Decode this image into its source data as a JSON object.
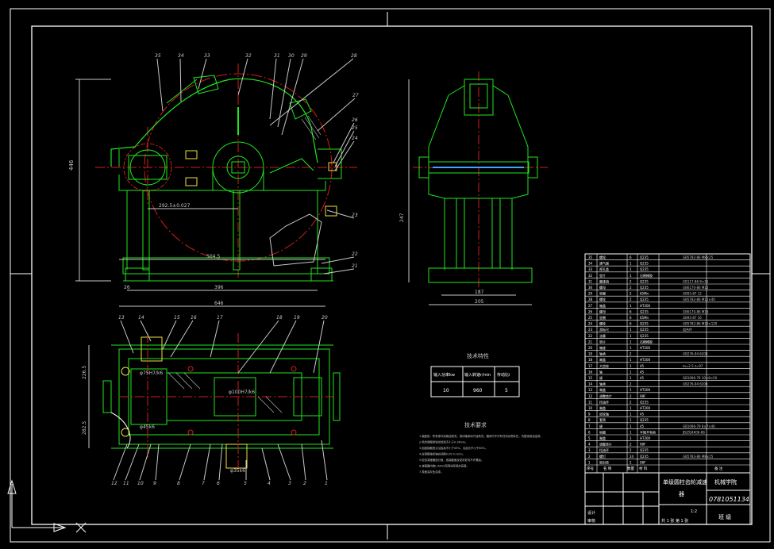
{
  "drawing": {
    "title_line1": "单级圆柱齿轮减速",
    "title_line2": "器",
    "school": "机械学院",
    "drawing_no": "0781051134",
    "class_label": "班 级",
    "scale": "1:2",
    "drawn_label": "设计",
    "checked_label": "审核",
    "sheet_note": "共 1 张 第 1 张"
  },
  "tech_spec": {
    "title": "技术特性",
    "headers": [
      "输入功率kw",
      "输入转速r/min",
      "传动比i"
    ],
    "values": [
      "10",
      "960",
      "5"
    ]
  },
  "tech_req": {
    "title": "技术要求",
    "lines": [
      "1.装配前，所有零件用煤油清洗，滚动轴承用汽油清洗，箱体内不许有任何杂物存在，内壁涂耐油油漆。",
      "2.啮合侧隙用铅丝检验不小于0.16mm。",
      "3.齿面接触斑点沿齿高不小于45%，沿齿长不小于60%。",
      "4.应调整轴承轴向间隙0.05-0.1mm。",
      "5.检查减速器剖分面，各接触面及密封处均不许漏油。",
      "6.减速器内装L-AN15润滑油至规定高度。",
      "7.表面涂灰色油漆。"
    ]
  },
  "dimensions": {
    "front_height": "446",
    "front_center": "292.5±0.027",
    "front_inner": "504.5",
    "front_base": "396",
    "front_total": "646",
    "front_left": "26",
    "side_height": "247",
    "side_width1": "187",
    "side_width2": "205",
    "top_d1": "φ75H7/k6",
    "top_d2": "φ100H7/k6",
    "top_d3": "φ45k6",
    "top_d4": "φ35k6",
    "top_h1": "226.5",
    "top_h2": "282.5"
  },
  "callouts_front": [
    "35",
    "34",
    "33",
    "32",
    "31",
    "30",
    "29",
    "28",
    "27",
    "26",
    "25",
    "24",
    "23",
    "22",
    "21"
  ],
  "callouts_top": [
    "13",
    "14",
    "15",
    "16",
    "17",
    "18",
    "19",
    "20",
    "12",
    "11",
    "10",
    "9",
    "8",
    "7",
    "6",
    "5",
    "4",
    "3",
    "2",
    "1"
  ],
  "bom": {
    "rows": [
      [
        "35",
        "螺栓",
        "6",
        "Q235",
        "GB5782-86 M8×25"
      ],
      [
        "34",
        "通气器",
        "1",
        "Q235",
        ""
      ],
      [
        "33",
        "视孔盖",
        "1",
        "Q235",
        ""
      ],
      [
        "32",
        "垫片",
        "1",
        "石棉橡胶",
        ""
      ],
      [
        "31",
        "圆锥销",
        "2",
        "Q235",
        "GB117-86 8×35"
      ],
      [
        "30",
        "螺母",
        "2",
        "Q235",
        "GB6170-86 M12"
      ],
      [
        "29",
        "垫圈",
        "2",
        "65Mn",
        "GB93-87 12"
      ],
      [
        "28",
        "螺栓",
        "2",
        "Q235",
        "GB5782-86 M12×40"
      ],
      [
        "27",
        "箱盖",
        "1",
        "HT200",
        ""
      ],
      [
        "26",
        "螺母",
        "6",
        "Q235",
        "GB6170-86 M16"
      ],
      [
        "25",
        "垫圈",
        "6",
        "65Mn",
        "GB93-87 16"
      ],
      [
        "24",
        "螺栓",
        "6",
        "Q235",
        "GB5782-86 M16×120"
      ],
      [
        "23",
        "游标尺",
        "1",
        "Q235",
        "组合件"
      ],
      [
        "22",
        "油塞",
        "1",
        "Q235",
        ""
      ],
      [
        "21",
        "垫片",
        "1",
        "石棉橡胶",
        ""
      ],
      [
        "20",
        "箱座",
        "1",
        "HT200",
        ""
      ],
      [
        "19",
        "轴承",
        "2",
        "",
        "GB276-94 6208"
      ],
      [
        "18",
        "端盖",
        "1",
        "HT200",
        ""
      ],
      [
        "17",
        "大齿轮",
        "1",
        "45",
        "m=2.5 z=97"
      ],
      [
        "16",
        "轴",
        "1",
        "45",
        ""
      ],
      [
        "15",
        "键",
        "1",
        "45",
        "GB1096-79 10×8×50"
      ],
      [
        "14",
        "轴承",
        "2",
        "",
        "GB276-94 6206"
      ],
      [
        "13",
        "端盖",
        "1",
        "HT200",
        ""
      ],
      [
        "12",
        "调整垫片",
        "2",
        "08F",
        ""
      ],
      [
        "11",
        "挡油环",
        "2",
        "Q235",
        ""
      ],
      [
        "10",
        "端盖",
        "1",
        "HT200",
        ""
      ],
      [
        "9",
        "齿轮轴",
        "1",
        "45",
        ""
      ],
      [
        "8",
        "套筒",
        "1",
        "Q235",
        ""
      ],
      [
        "7",
        "键",
        "1",
        "45",
        "GB1096-79 8×7×40"
      ],
      [
        "6",
        "毡圈",
        "1",
        "半粗羊毛毡",
        "JB/ZQ4606-86"
      ],
      [
        "5",
        "端盖",
        "1",
        "HT200",
        ""
      ],
      [
        "4",
        "调整垫片",
        "2",
        "08F",
        ""
      ],
      [
        "3",
        "挡油环",
        "2",
        "Q235",
        ""
      ],
      [
        "2",
        "螺钉",
        "24",
        "Q235",
        "GB5783-86 M8×25"
      ],
      [
        "1",
        "密封垫",
        "2",
        "08F",
        ""
      ]
    ],
    "header": [
      "序号",
      "名 称",
      "数量",
      "材 料",
      "备 注"
    ]
  }
}
